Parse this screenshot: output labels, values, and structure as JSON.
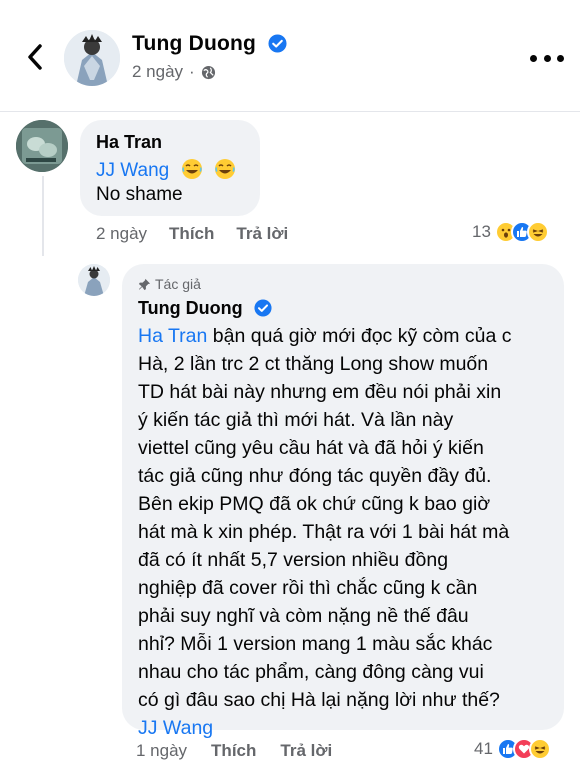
{
  "header": {
    "author_name": "Tung Duong",
    "time": "2 ngày"
  },
  "comment1": {
    "name": "Ha Tran",
    "mention": "JJ Wang",
    "text": "No shame",
    "time": "2 ngày",
    "like_label": "Thích",
    "reply_label": "Trả lời",
    "reaction_count": "13"
  },
  "reply": {
    "author_tag": "Tác giả",
    "name": "Tung Duong",
    "mention_start": "Ha Tran",
    "body_lines": [
      " bận quá giờ mới đọc kỹ còm của c",
      "Hà, 2 lần trc 2 ct thăng Long show muốn",
      "TD hát bài này nhưng em đều nói phải xin",
      "ý kiến tác giả thì mới hát. Và lần này",
      "viettel cũng yêu cầu hát và đã hỏi ý kiến",
      "tác giả cũng như đóng tác quyền đầy đủ.",
      "Bên ekip PMQ đã ok chứ cũng k bao giờ",
      "hát mà k xin phép. Thật ra với 1 bài hát mà",
      "đã có ít nhất 5,7 version nhiều đồng",
      "nghiệp đã cover rồi thì chắc cũng k cần",
      "phải suy nghĩ và còm nặng nề thế đâu",
      "nhỉ? Mỗi 1 version mang 1 màu sắc khác",
      "nhau cho tác phẩm, càng đông càng vui",
      "có gì đâu sao chị Hà lại nặng lời như thế?"
    ],
    "mention_end": "JJ Wang",
    "time": "1 ngày",
    "like_label": "Thích",
    "reply_label": "Trả lời",
    "reaction_count": "41"
  },
  "colors": {
    "accent": "#1877f2",
    "bubble": "#f0f2f5",
    "secondary_text": "#65676b"
  },
  "icons": [
    "back-arrow-icon",
    "verified-badge-icon",
    "globe-icon",
    "more-dots-icon",
    "laugh-emoji-icon",
    "pin-icon",
    "wow-reaction-icon",
    "like-reaction-icon",
    "haha-reaction-icon",
    "love-reaction-icon"
  ]
}
